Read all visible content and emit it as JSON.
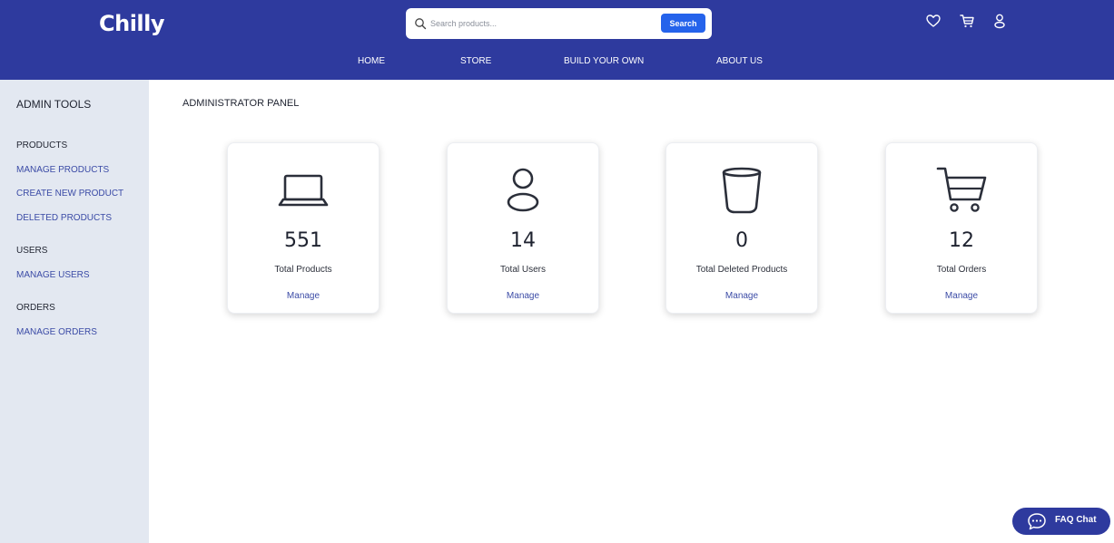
{
  "header": {
    "logo": "Chilly",
    "search": {
      "placeholder": "Search products...",
      "value": "",
      "button_label": "Search"
    },
    "icons": [
      "heart-icon",
      "cart-icon",
      "user-icon"
    ],
    "nav": [
      "HOME",
      "STORE",
      "BUILD YOUR OWN",
      "ABOUT US"
    ]
  },
  "sidebar": {
    "title": "ADMIN TOOLS",
    "sections": [
      {
        "heading": "PRODUCTS",
        "links": [
          "MANAGE PRODUCTS",
          "CREATE NEW PRODUCT",
          "DELETED PRODUCTS"
        ]
      },
      {
        "heading": "USERS",
        "links": [
          "MANAGE USERS"
        ]
      },
      {
        "heading": "ORDERS",
        "links": [
          "MANAGE ORDERS"
        ]
      }
    ]
  },
  "main": {
    "title": "ADMINISTRATOR PANEL",
    "cards": [
      {
        "icon": "laptop-icon",
        "count": "551",
        "label": "Total Products",
        "action": "Manage"
      },
      {
        "icon": "user-icon",
        "count": "14",
        "label": "Total Users",
        "action": "Manage"
      },
      {
        "icon": "trash-icon",
        "count": "0",
        "label": "Total Deleted Products",
        "action": "Manage"
      },
      {
        "icon": "cart-icon",
        "count": "12",
        "label": "Total Orders",
        "action": "Manage"
      }
    ]
  },
  "faq": {
    "label": "FAQ Chat",
    "icon": "chat-icon"
  },
  "colors": {
    "brand": "#2e3a9e",
    "accent": "#2563eb",
    "link": "#3b4ba6",
    "sidebar_bg": "#e3e8f1"
  }
}
